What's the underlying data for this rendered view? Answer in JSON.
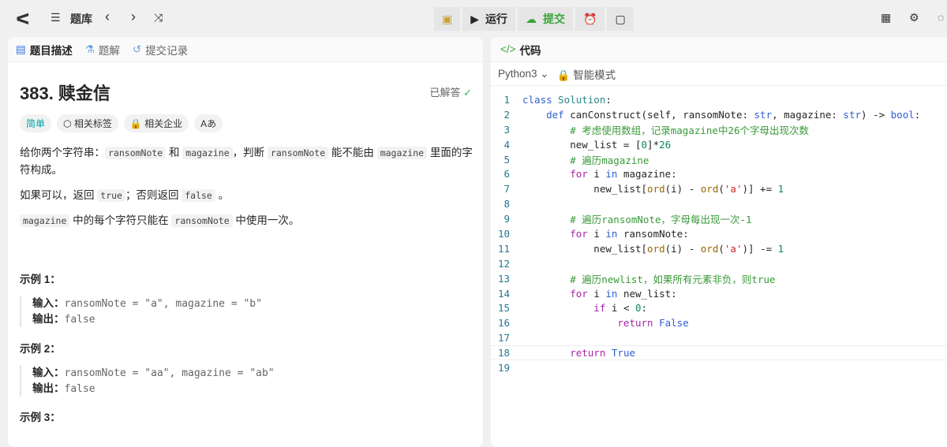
{
  "topbar": {
    "library": "题库",
    "run": "运行",
    "submit": "提交"
  },
  "left": {
    "tabs": [
      "题目描述",
      "题解",
      "提交记录"
    ],
    "title": "383. 赎金信",
    "status": "已解答",
    "chips": [
      "简单",
      "相关标签",
      "相关企业",
      "Aあ"
    ],
    "desc": {
      "p1a": "给你两个字符串：",
      "c1": "ransomNote",
      "p1b": " 和 ",
      "c2": "magazine",
      "p1c": "，判断 ",
      "c3": "ransomNote",
      "p1d": " 能不能由 ",
      "c4": "magazine",
      "p1e": " 里面的字符构成。",
      "p2a": "如果可以，返回 ",
      "c5": "true",
      "p2b": "；否则返回 ",
      "c6": "false",
      "p2c": " 。",
      "c7": "magazine",
      "p3a": " 中的每个字符只能在 ",
      "c8": "ransomNote",
      "p3b": " 中使用一次。"
    },
    "examples": [
      {
        "heading": "示例 1：",
        "in_label": "输入：",
        "input": "ransomNote = \"a\", magazine = \"b\"",
        "out_label": "输出：",
        "output": "false"
      },
      {
        "heading": "示例 2：",
        "in_label": "输入：",
        "input": "ransomNote = \"aa\", magazine = \"ab\"",
        "out_label": "输出：",
        "output": "false"
      },
      {
        "heading": "示例 3："
      }
    ]
  },
  "right": {
    "tab": "代码",
    "language": "Python3",
    "mode": "智能模式",
    "lines": [
      [
        [
          "class ",
          "kb"
        ],
        [
          "Solution",
          "cls"
        ],
        [
          ":",
          ""
        ]
      ],
      [
        [
          "    def ",
          "kb"
        ],
        [
          "canConstruct",
          ""
        ],
        [
          "(self, ransomNote: ",
          ""
        ],
        [
          "str",
          "kb"
        ],
        [
          ", magazine: ",
          ""
        ],
        [
          "str",
          "kb"
        ],
        [
          ") -> ",
          ""
        ],
        [
          "bool",
          "kb"
        ],
        [
          ":",
          ""
        ]
      ],
      [
        [
          "        # 考虑使用数组，记录magazine中26个字母出现次数",
          "cm"
        ]
      ],
      [
        [
          "        new_list = [",
          ""
        ],
        [
          "0",
          "num"
        ],
        [
          "]*",
          ""
        ],
        [
          "26",
          "num"
        ]
      ],
      [
        [
          "        # 遍历magazine",
          "cm"
        ]
      ],
      [
        [
          "        for ",
          "kw"
        ],
        [
          "i ",
          ""
        ],
        [
          "in ",
          "kb"
        ],
        [
          "magazine:",
          ""
        ]
      ],
      [
        [
          "            new_list[",
          ""
        ],
        [
          "ord",
          "fn"
        ],
        [
          "(i) - ",
          ""
        ],
        [
          "ord",
          "fn"
        ],
        [
          "(",
          ""
        ],
        [
          "'a'",
          "str"
        ],
        [
          ")] += ",
          ""
        ],
        [
          "1",
          "num"
        ]
      ],
      [
        [
          "",
          ""
        ]
      ],
      [
        [
          "        # 遍历ransomNote，字母每出现一次-1",
          "cm"
        ]
      ],
      [
        [
          "        for ",
          "kw"
        ],
        [
          "i ",
          ""
        ],
        [
          "in ",
          "kb"
        ],
        [
          "ransomNote:",
          ""
        ]
      ],
      [
        [
          "            new_list[",
          ""
        ],
        [
          "ord",
          "fn"
        ],
        [
          "(i) - ",
          ""
        ],
        [
          "ord",
          "fn"
        ],
        [
          "(",
          ""
        ],
        [
          "'a'",
          "str"
        ],
        [
          ")] -= ",
          ""
        ],
        [
          "1",
          "num"
        ]
      ],
      [
        [
          "",
          ""
        ]
      ],
      [
        [
          "        # 遍历newlist，如果所有元素非负，则true",
          "cm"
        ]
      ],
      [
        [
          "        for ",
          "kw"
        ],
        [
          "i ",
          ""
        ],
        [
          "in ",
          "kb"
        ],
        [
          "new_list:",
          ""
        ]
      ],
      [
        [
          "            if ",
          "kw"
        ],
        [
          "i < ",
          ""
        ],
        [
          "0",
          "num"
        ],
        [
          ":",
          ""
        ]
      ],
      [
        [
          "                return ",
          "kw"
        ],
        [
          "False",
          "kb"
        ]
      ],
      [
        [
          "",
          ""
        ]
      ],
      [
        [
          "        return ",
          "kw"
        ],
        [
          "True",
          "kb"
        ]
      ],
      [
        [
          "",
          ""
        ]
      ]
    ]
  }
}
